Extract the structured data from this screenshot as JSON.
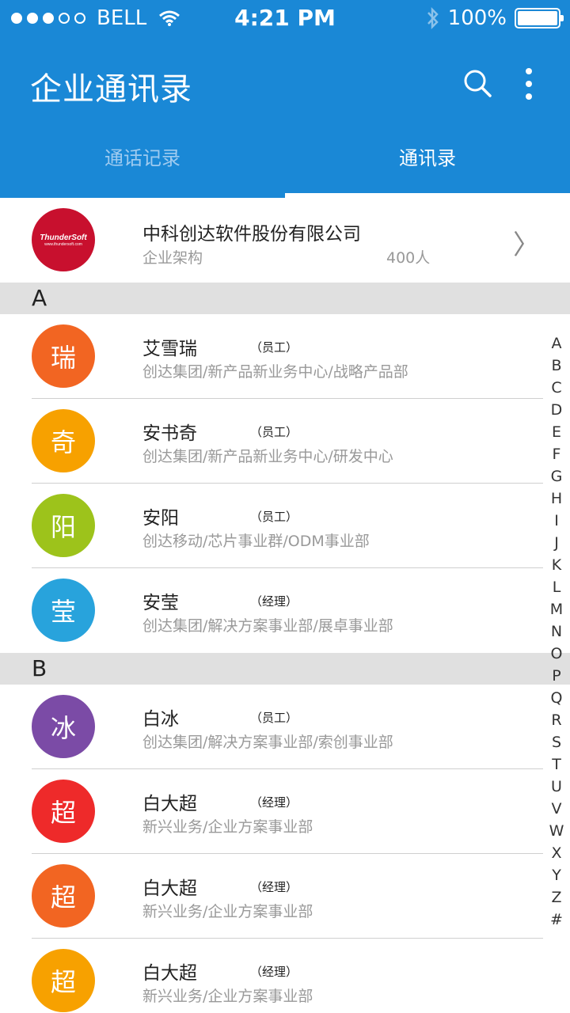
{
  "status_bar": {
    "signal_dots": [
      true,
      true,
      true,
      false,
      false
    ],
    "carrier": "BELL",
    "time": "4:21 PM",
    "battery": "100%",
    "battery_level": 1.0
  },
  "header": {
    "title": "企业通讯录",
    "search_icon": "search-icon",
    "more_icon": "more-vertical-icon",
    "accent_color": "#1a88d6"
  },
  "tabs": [
    {
      "label": "通话记录",
      "active": false
    },
    {
      "label": "通讯录",
      "active": true
    }
  ],
  "company": {
    "logo_text": "ThunderSoft",
    "logo_site": "www.thundersoft.com",
    "name": "中科创达软件股份有限公司",
    "subtitle": "企业架构",
    "count": "400人"
  },
  "sections": [
    {
      "letter": "A",
      "contacts": [
        {
          "avatar_char": "瑞",
          "color": "#f26522",
          "name": "艾雪瑞",
          "role": "（员工）",
          "dept": "创达集团/新产品新业务中心/战略产品部"
        },
        {
          "avatar_char": "奇",
          "color": "#f7a100",
          "name": "安书奇",
          "role": "（员工）",
          "dept": "创达集团/新产品新业务中心/研发中心"
        },
        {
          "avatar_char": "阳",
          "color": "#9dc31b",
          "name": "安阳",
          "role": "（员工）",
          "dept": "创达移动/芯片事业群/ODM事业部"
        },
        {
          "avatar_char": "莹",
          "color": "#28a3dc",
          "name": "安莹",
          "role": "（经理）",
          "dept": "创达集团/解决方案事业部/展卓事业部"
        }
      ]
    },
    {
      "letter": "B",
      "contacts": [
        {
          "avatar_char": "冰",
          "color": "#7b4ba6",
          "name": "白冰",
          "role": "（员工）",
          "dept": "创达集团/解决方案事业部/索创事业部"
        },
        {
          "avatar_char": "超",
          "color": "#ee2a2a",
          "name": "白大超",
          "role": "（经理）",
          "dept": "新兴业务/企业方案事业部"
        },
        {
          "avatar_char": "超",
          "color": "#f26522",
          "name": "白大超",
          "role": "（经理）",
          "dept": "新兴业务/企业方案事业部"
        },
        {
          "avatar_char": "超",
          "color": "#f7a100",
          "name": "白大超",
          "role": "（经理）",
          "dept": "新兴业务/企业方案事业部"
        }
      ]
    }
  ],
  "index_letters": [
    "A",
    "B",
    "C",
    "D",
    "E",
    "F",
    "G",
    "H",
    "I",
    "J",
    "K",
    "L",
    "M",
    "N",
    "O",
    "P",
    "Q",
    "R",
    "S",
    "T",
    "U",
    "V",
    "W",
    "X",
    "Y",
    "Z",
    "#"
  ]
}
